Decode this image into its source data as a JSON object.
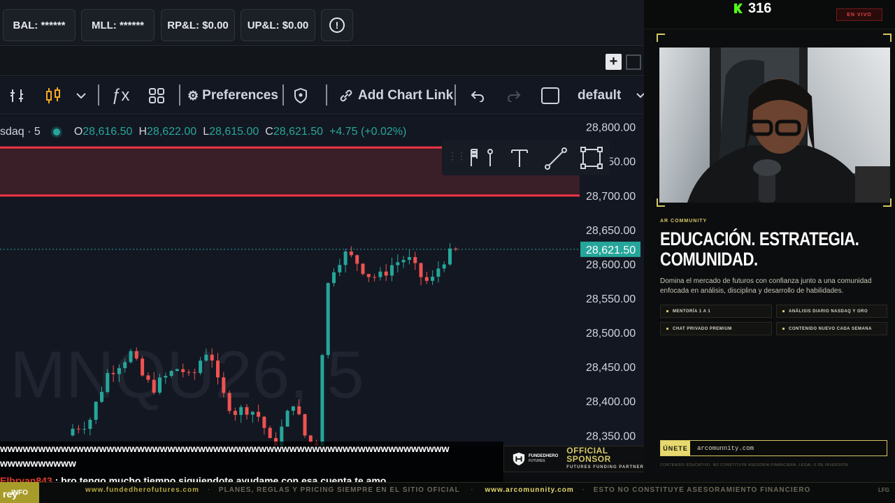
{
  "account": {
    "bal": "BAL: ******",
    "mll": "MLL: ******",
    "rpl": "RP&L: $0.00",
    "upl": "UP&L: $0.00",
    "alert_icon": "alert-circle-icon"
  },
  "toolbar": {
    "preferences": "Preferences",
    "add_chart_link": "Add Chart Link",
    "layout": "default",
    "fx": "ƒx"
  },
  "legend": {
    "symbol": "sdaq · 5",
    "o_label": "O",
    "o_value": "28,616.50",
    "h_label": "H",
    "h_value": "28,622.00",
    "l_label": "L",
    "l_value": "28,615.00",
    "c_label": "C",
    "c_value": "28,621.50",
    "change": "+4.75 (+0.02%)"
  },
  "chart_data": {
    "type": "candlestick",
    "watermark": "MNQU26, 5",
    "current_price": "28,621.50",
    "y_ticks": [
      "28,800.00",
      "28,750.00",
      "28,700.00",
      "28,650.00",
      "28,600.00",
      "28,550.00",
      "28,500.00",
      "28,450.00",
      "28,400.00",
      "28,350.00"
    ],
    "y_values": [
      28800,
      28750,
      28700,
      28650,
      28600,
      28550,
      28500,
      28450,
      28400,
      28350
    ],
    "ylim": [
      28335,
      28817
    ],
    "zone": [
      28700,
      28770
    ],
    "up_color": "#26a69a",
    "down_color": "#ef5350"
  },
  "chat": {
    "line1": "wwwwwwwwwwwwwwwwwwwwwwwwwwwwwwwwwwwwwwwwwwwwwwwwwwwwwwwwwww",
    "line2": "wwwwwwwwww",
    "user": "Elbryan843",
    "message": " : bro tengo mucho tiempo siguiendote ayudame con esa cuenta te amo",
    "user2": "rey"
  },
  "sponsor": {
    "logo_top": "FUNDEDHERO",
    "logo_bottom": "FUTURES",
    "title": "OFFICIAL SPONSOR",
    "subtitle": "FUTURES FUNDING PARTNER"
  },
  "ticker": {
    "badge": "INFO",
    "site1": "www.fundedherofutures.com",
    "text1": "PLANES, REGLAS Y PRICING SIEMPRE EN EL SITIO OFICIAL",
    "site2": "www.arcomunnity.com",
    "text2": "ESTO NO CONSTITUYE ASESORAMIENTO FINANCIERO",
    "end": "LFG"
  },
  "stream": {
    "viewers": "316",
    "live": "EN VIVO",
    "eyebrow": "AR COMMUNITY",
    "title_line1": "EDUCACIÓN. ESTRATEGIA.",
    "title_line2": "COMUNIDAD.",
    "description": "Domina el mercado de futuros con confianza junto a una comunidad enfocada en análisis, disciplina y desarrollo de habilidades.",
    "features": [
      "MENTORÍA 1 A 1",
      "ANÁLISIS DIARIO NASDAQ Y ORO",
      "CHAT PRIVADO PREMIUM",
      "CONTENIDO NUEVO CADA SEMANA"
    ],
    "join_label": "ÚNETE",
    "join_url": "arcomunnity.com",
    "disclaimer": "CONTENIDO EDUCATIVO. NO CONSTITUYE ASESORÍA FINANCIERA, LEGAL O DE INVERSIÓN."
  }
}
